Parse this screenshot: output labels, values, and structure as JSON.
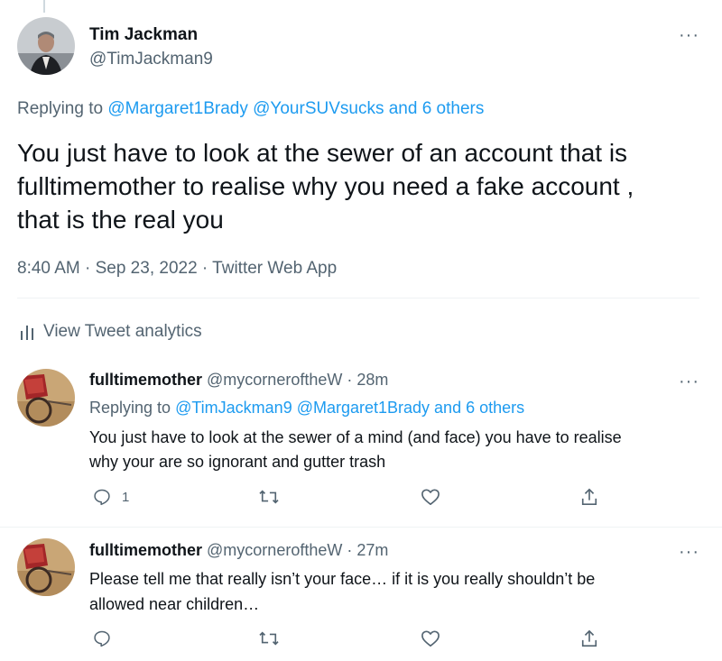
{
  "main_tweet": {
    "author_name": "Tim Jackman",
    "author_handle": "@TimJackman9",
    "replying_prefix": "Replying to",
    "replying_to": "@Margaret1Brady @YourSUVsucks and 6 others",
    "text_lines": [
      "You just have to look at the sewer of an account that is",
      "fulltimemother to realise why you need a fake account ,",
      "that is the real you"
    ],
    "meta": "8:40 AM · Sep 23, 2022 · Twitter Web App",
    "analytics_label": "View Tweet analytics"
  },
  "replies": [
    {
      "author_name": "fulltimemother",
      "author_handle": "@mycorneroftheW",
      "time": "· 28m",
      "replying_prefix": "Replying to",
      "replying_to": "@TimJackman9 @Margaret1Brady and 6 others",
      "text_lines": [
        "You just have to look at the sewer of a mind (and face) you have to realise",
        "why your are so ignorant and gutter trash"
      ],
      "reply_count": "1"
    },
    {
      "author_name": "fulltimemother",
      "author_handle": "@mycorneroftheW",
      "time": "· 27m",
      "text_lines": [
        "Please tell me that really isn’t your face… if it is you really shouldn’t be",
        "allowed near children…"
      ],
      "reply_count": ""
    }
  ],
  "icons": {
    "more": "more-horizontal-icon",
    "reply": "reply-bubble-icon",
    "retweet": "retweet-icon",
    "like": "heart-icon",
    "share": "share-upload-icon",
    "analytics": "bar-chart-icon"
  },
  "colors": {
    "link": "#1d9bf0",
    "muted": "#536471",
    "text": "#0f1419",
    "divider": "#eff3f4"
  }
}
